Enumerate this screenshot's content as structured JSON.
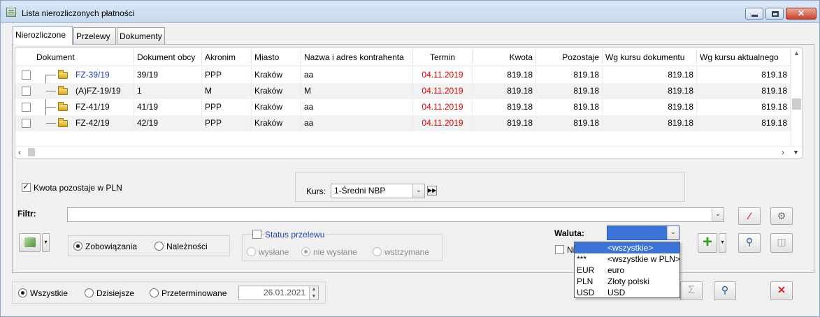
{
  "window": {
    "title": "Lista nierozliczonych płatności",
    "close_glyph": "✕"
  },
  "tabs": [
    {
      "label": "Nierozliczone",
      "active": true
    },
    {
      "label": "Przelewy",
      "active": false
    },
    {
      "label": "Dokumenty",
      "active": false
    }
  ],
  "grid": {
    "columns": [
      "Dokument",
      "Dokument obcy",
      "Akronim",
      "Miasto",
      "Nazwa i adres kontrahenta",
      "Termin",
      "Kwota",
      "Pozostaje",
      "Wg kursu dokumentu",
      "Wg kursu aktualnego"
    ],
    "rows": [
      {
        "dokument": "FZ-39/19",
        "obcy": "39/19",
        "akronim": "PPP",
        "miasto": "Kraków",
        "nazwa": "aa",
        "termin": "04.11.2019",
        "kwota": "819.18",
        "pozostaje": "819.18",
        "wg_dok": "819.18",
        "wg_akt": "819.18",
        "highlight": true
      },
      {
        "dokument": "(A)FZ-19/19",
        "obcy": "1",
        "akronim": "M",
        "miasto": "Kraków",
        "nazwa": "M",
        "termin": "04.11.2019",
        "kwota": "819.18",
        "pozostaje": "819.18",
        "wg_dok": "819.18",
        "wg_akt": "819.18",
        "highlight": false
      },
      {
        "dokument": "FZ-41/19",
        "obcy": "41/19",
        "akronim": "PPP",
        "miasto": "Kraków",
        "nazwa": "aa",
        "termin": "04.11.2019",
        "kwota": "819.18",
        "pozostaje": "819.18",
        "wg_dok": "819.18",
        "wg_akt": "819.18",
        "highlight": false
      },
      {
        "dokument": "FZ-42/19",
        "obcy": "42/19",
        "akronim": "PPP",
        "miasto": "Kraków",
        "nazwa": "aa",
        "termin": "04.11.2019",
        "kwota": "819.18",
        "pozostaje": "819.18",
        "wg_dok": "819.18",
        "wg_akt": "819.18",
        "highlight": false
      }
    ]
  },
  "options": {
    "kwota_pln_label": "Kwota pozostaje w PLN",
    "kurs_label": "Kurs:",
    "kurs_value": "1-Średni NBP",
    "filtr_label": "Filtr:",
    "filtr_value": "",
    "zobowiazania_label": "Zobowiązania",
    "naleznosci_label": "Należności",
    "status_label": "Status przelewu",
    "wyslane_label": "wysłane",
    "nie_wyslane_label": "nie wysłane",
    "wstrzymane_label": "wstrzymane",
    "waluta_label": "Waluta:",
    "waluta_value": "",
    "hidden_check_label": "Ni"
  },
  "waluta_dropdown": [
    {
      "code": "",
      "name": "<wszystkie>",
      "selected": true
    },
    {
      "code": "***",
      "name": "<wszystkie w PLN>",
      "selected": false
    },
    {
      "code": "EUR",
      "name": "euro",
      "selected": false
    },
    {
      "code": "PLN",
      "name": "Złoty polski",
      "selected": false
    },
    {
      "code": "USD",
      "name": "USD",
      "selected": false
    }
  ],
  "footer": {
    "wszystkie_label": "Wszystkie",
    "dzisiejsze_label": "Dzisiejsze",
    "przeterminowane_label": "Przeterminowane",
    "date_value": "26.01.2021"
  },
  "icons": {
    "sigma": "Σ",
    "add": "+",
    "close_red": "✕"
  },
  "colors": {
    "accent": "#3b73d6",
    "overdue": "#e00000",
    "link": "#1f3fb0",
    "add_green": "#2fa31f",
    "delete_red": "#d9201a"
  }
}
